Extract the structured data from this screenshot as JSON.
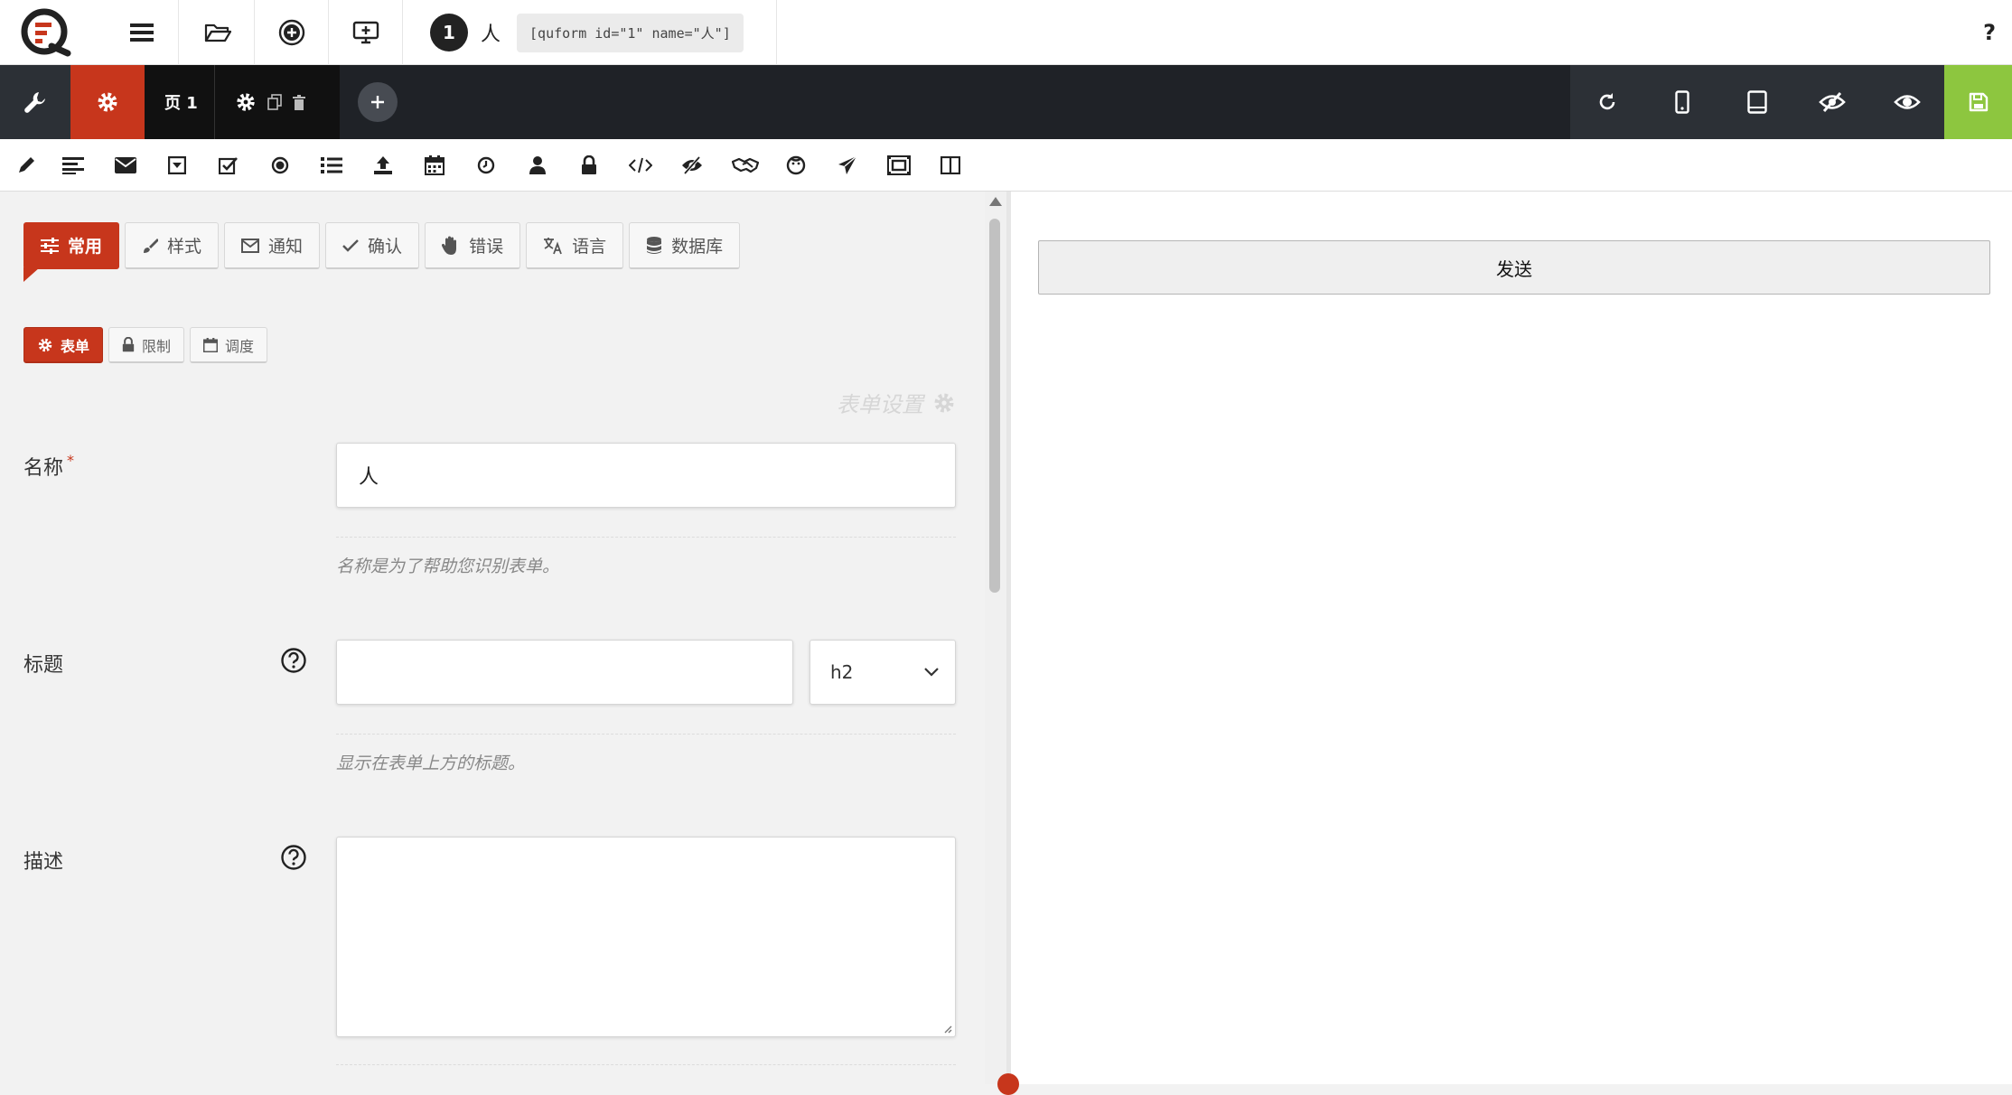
{
  "topbar": {
    "form_number": "1",
    "form_name": "人",
    "shortcode": "[quform id=\"1\" name=\"人\"]",
    "help_label": "?"
  },
  "darkbar": {
    "page_label": "页 1",
    "accent_color": "#c7361c",
    "save_color": "#8dc63f"
  },
  "element_toolbar": [
    "pencil-icon",
    "text-lines-icon",
    "envelope-icon",
    "dropdown-icon",
    "checkbox-icon",
    "radio-icon",
    "list-icon",
    "upload-icon",
    "calendar-icon",
    "clock-icon",
    "user-icon",
    "lock-icon",
    "code-icon",
    "eye-slash-icon",
    "handshake-icon",
    "smiley-icon",
    "paper-plane-icon",
    "group-icon",
    "columns-icon"
  ],
  "settings": {
    "tabs": [
      "常用",
      "样式",
      "通知",
      "确认",
      "错误",
      "语言",
      "数据库"
    ],
    "subtabs": [
      "表单",
      "限制",
      "调度"
    ],
    "section_title": "表单设置",
    "name_label": "名称",
    "required_mark": "*",
    "name_value": "人",
    "name_hint": "名称是为了帮助您识别表单。",
    "title_label": "标题",
    "title_value": "",
    "title_tag": "h2",
    "title_hint": "显示在表单上方的标题。",
    "description_label": "描述"
  },
  "preview": {
    "submit_label": "发送"
  }
}
